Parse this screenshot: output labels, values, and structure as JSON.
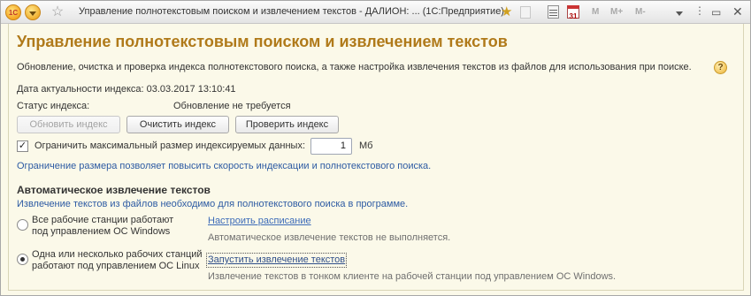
{
  "window": {
    "title": "Управление полнотекстовым поиском и извлечением текстов - ДАЛИОН: ... (1С:Предприятие)",
    "logo": "1С",
    "toolbar_labels": {
      "m": "M",
      "m_plus": "M+",
      "m_minus": "M-"
    }
  },
  "page": {
    "heading": "Управление полнотекстовым поиском и извлечением текстов",
    "description": "Обновление, очистка и проверка индекса полнотекстового поиска, а также настройка извлечения текстов из файлов для использования при поиске.",
    "help_glyph": "?",
    "index_date_label": "Дата актуальности индекса: 03.03.2017 13:10:41",
    "index_status_label": "Статус индекса:",
    "index_status_value": "Обновление не требуется"
  },
  "buttons": {
    "update_index": "Обновить индекс",
    "clear_index": "Очистить индекс",
    "check_index": "Проверить индекс"
  },
  "limit": {
    "checkbox_label": "Ограничить максимальный размер индексируемых данных:",
    "checked": true,
    "value": "1",
    "unit": "Мб",
    "hint": "Ограничение размера позволяет повысить скорость индексации и полнотекстового поиска."
  },
  "extraction": {
    "title": "Автоматическое извлечение текстов",
    "hint": "Извлечение текстов из файлов необходимо для полнотекстового поиска в программе.",
    "option_windows_line1": "Все рабочие станции работают",
    "option_windows_line2": "под управлением ОС Windows",
    "option_windows_selected": false,
    "schedule_link": "Настроить расписание",
    "schedule_status": "Автоматическое извлечение текстов не выполняется.",
    "option_linux_line1": "Одна или несколько рабочих станций",
    "option_linux_line2": "работают под управлением ОС Linux",
    "option_linux_selected": true,
    "run_link": "Запустить извлечение текстов",
    "run_status": "Извлечение текстов в тонком клиенте на рабочей станции под управлением ОС Windows."
  },
  "colors": {
    "heading": "#b07a1a",
    "hint_blue": "#2d5ba3",
    "link": "#3c6bb8",
    "background": "#fbf9e9"
  }
}
